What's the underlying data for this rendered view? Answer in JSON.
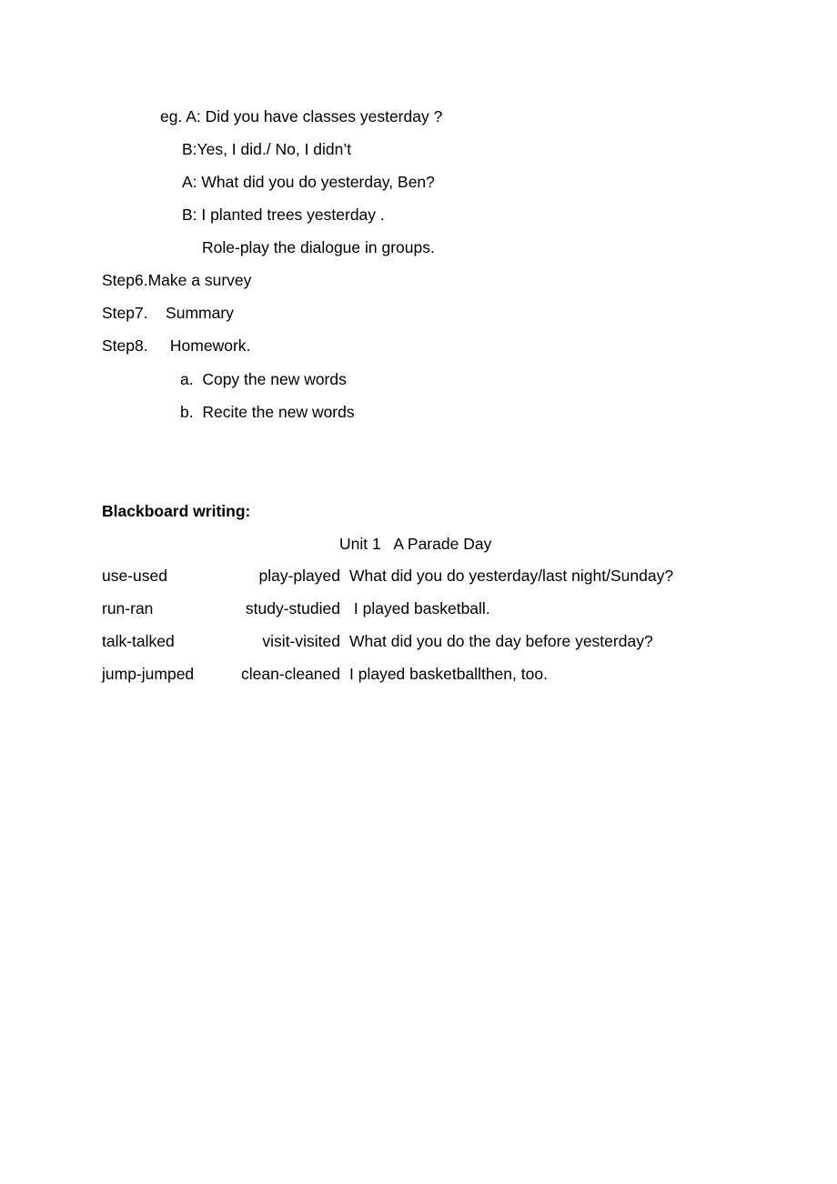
{
  "document": {
    "dialogue": {
      "example_line": "eg. A: Did you have classes yesterday ?",
      "reply_b1": "B:Yes, I did./ No, I didn’t",
      "question_a2": "A: What did you do yesterday, Ben?",
      "reply_b2": "B: I planted trees yesterday .",
      "instruction": "Role-play the dialogue in groups."
    },
    "steps": [
      {
        "label": "Step6.Make a survey"
      },
      {
        "label": "Step7.    Summary"
      },
      {
        "label": "Step8.     Homework."
      }
    ],
    "homework_items": [
      {
        "label": "a.  Copy the new words"
      },
      {
        "label": "b.  Recite the new words"
      }
    ],
    "blackboard": {
      "heading": "Blackboard writing:",
      "title": "Unit 1   A Parade Day",
      "rows": [
        {
          "verb1": "use-used",
          "verb2": "play-played",
          "sentence": "What did you do yesterday/last night/Sunday?"
        },
        {
          "verb1": "run-ran",
          "verb2": "study-studied",
          "sentence": " I played basketball."
        },
        {
          "verb1": "talk-talked",
          "verb2": "visit-visited",
          "sentence": "What did you do the day before yesterday?"
        },
        {
          "verb1": "jump-jumped",
          "verb2": "clean-cleaned",
          "sentence": "I played basketballthen, too."
        }
      ]
    }
  }
}
